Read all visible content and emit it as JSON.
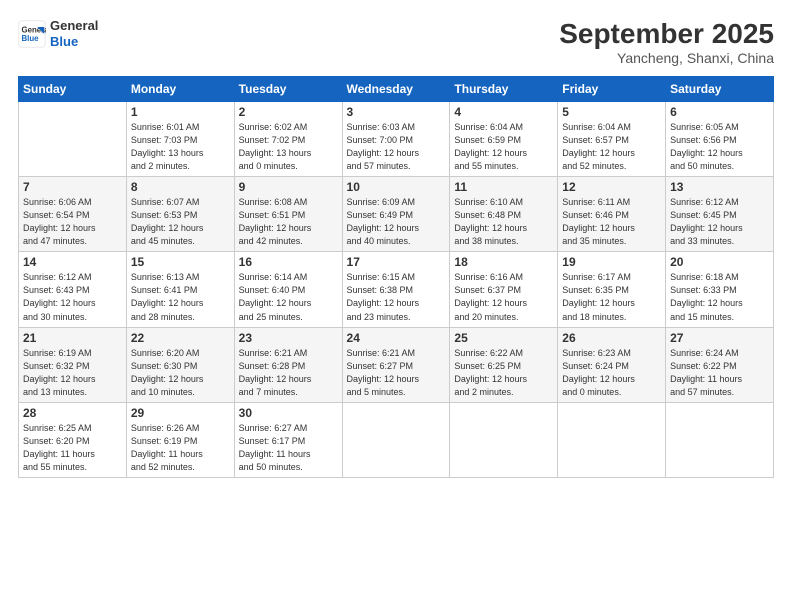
{
  "header": {
    "logo_line1": "General",
    "logo_line2": "Blue",
    "month_title": "September 2025",
    "location": "Yancheng, Shanxi, China"
  },
  "weekdays": [
    "Sunday",
    "Monday",
    "Tuesday",
    "Wednesday",
    "Thursday",
    "Friday",
    "Saturday"
  ],
  "weeks": [
    [
      {
        "day": "",
        "detail": ""
      },
      {
        "day": "1",
        "detail": "Sunrise: 6:01 AM\nSunset: 7:03 PM\nDaylight: 13 hours\nand 2 minutes."
      },
      {
        "day": "2",
        "detail": "Sunrise: 6:02 AM\nSunset: 7:02 PM\nDaylight: 13 hours\nand 0 minutes."
      },
      {
        "day": "3",
        "detail": "Sunrise: 6:03 AM\nSunset: 7:00 PM\nDaylight: 12 hours\nand 57 minutes."
      },
      {
        "day": "4",
        "detail": "Sunrise: 6:04 AM\nSunset: 6:59 PM\nDaylight: 12 hours\nand 55 minutes."
      },
      {
        "day": "5",
        "detail": "Sunrise: 6:04 AM\nSunset: 6:57 PM\nDaylight: 12 hours\nand 52 minutes."
      },
      {
        "day": "6",
        "detail": "Sunrise: 6:05 AM\nSunset: 6:56 PM\nDaylight: 12 hours\nand 50 minutes."
      }
    ],
    [
      {
        "day": "7",
        "detail": "Sunrise: 6:06 AM\nSunset: 6:54 PM\nDaylight: 12 hours\nand 47 minutes."
      },
      {
        "day": "8",
        "detail": "Sunrise: 6:07 AM\nSunset: 6:53 PM\nDaylight: 12 hours\nand 45 minutes."
      },
      {
        "day": "9",
        "detail": "Sunrise: 6:08 AM\nSunset: 6:51 PM\nDaylight: 12 hours\nand 42 minutes."
      },
      {
        "day": "10",
        "detail": "Sunrise: 6:09 AM\nSunset: 6:49 PM\nDaylight: 12 hours\nand 40 minutes."
      },
      {
        "day": "11",
        "detail": "Sunrise: 6:10 AM\nSunset: 6:48 PM\nDaylight: 12 hours\nand 38 minutes."
      },
      {
        "day": "12",
        "detail": "Sunrise: 6:11 AM\nSunset: 6:46 PM\nDaylight: 12 hours\nand 35 minutes."
      },
      {
        "day": "13",
        "detail": "Sunrise: 6:12 AM\nSunset: 6:45 PM\nDaylight: 12 hours\nand 33 minutes."
      }
    ],
    [
      {
        "day": "14",
        "detail": "Sunrise: 6:12 AM\nSunset: 6:43 PM\nDaylight: 12 hours\nand 30 minutes."
      },
      {
        "day": "15",
        "detail": "Sunrise: 6:13 AM\nSunset: 6:41 PM\nDaylight: 12 hours\nand 28 minutes."
      },
      {
        "day": "16",
        "detail": "Sunrise: 6:14 AM\nSunset: 6:40 PM\nDaylight: 12 hours\nand 25 minutes."
      },
      {
        "day": "17",
        "detail": "Sunrise: 6:15 AM\nSunset: 6:38 PM\nDaylight: 12 hours\nand 23 minutes."
      },
      {
        "day": "18",
        "detail": "Sunrise: 6:16 AM\nSunset: 6:37 PM\nDaylight: 12 hours\nand 20 minutes."
      },
      {
        "day": "19",
        "detail": "Sunrise: 6:17 AM\nSunset: 6:35 PM\nDaylight: 12 hours\nand 18 minutes."
      },
      {
        "day": "20",
        "detail": "Sunrise: 6:18 AM\nSunset: 6:33 PM\nDaylight: 12 hours\nand 15 minutes."
      }
    ],
    [
      {
        "day": "21",
        "detail": "Sunrise: 6:19 AM\nSunset: 6:32 PM\nDaylight: 12 hours\nand 13 minutes."
      },
      {
        "day": "22",
        "detail": "Sunrise: 6:20 AM\nSunset: 6:30 PM\nDaylight: 12 hours\nand 10 minutes."
      },
      {
        "day": "23",
        "detail": "Sunrise: 6:21 AM\nSunset: 6:28 PM\nDaylight: 12 hours\nand 7 minutes."
      },
      {
        "day": "24",
        "detail": "Sunrise: 6:21 AM\nSunset: 6:27 PM\nDaylight: 12 hours\nand 5 minutes."
      },
      {
        "day": "25",
        "detail": "Sunrise: 6:22 AM\nSunset: 6:25 PM\nDaylight: 12 hours\nand 2 minutes."
      },
      {
        "day": "26",
        "detail": "Sunrise: 6:23 AM\nSunset: 6:24 PM\nDaylight: 12 hours\nand 0 minutes."
      },
      {
        "day": "27",
        "detail": "Sunrise: 6:24 AM\nSunset: 6:22 PM\nDaylight: 11 hours\nand 57 minutes."
      }
    ],
    [
      {
        "day": "28",
        "detail": "Sunrise: 6:25 AM\nSunset: 6:20 PM\nDaylight: 11 hours\nand 55 minutes."
      },
      {
        "day": "29",
        "detail": "Sunrise: 6:26 AM\nSunset: 6:19 PM\nDaylight: 11 hours\nand 52 minutes."
      },
      {
        "day": "30",
        "detail": "Sunrise: 6:27 AM\nSunset: 6:17 PM\nDaylight: 11 hours\nand 50 minutes."
      },
      {
        "day": "",
        "detail": ""
      },
      {
        "day": "",
        "detail": ""
      },
      {
        "day": "",
        "detail": ""
      },
      {
        "day": "",
        "detail": ""
      }
    ]
  ]
}
